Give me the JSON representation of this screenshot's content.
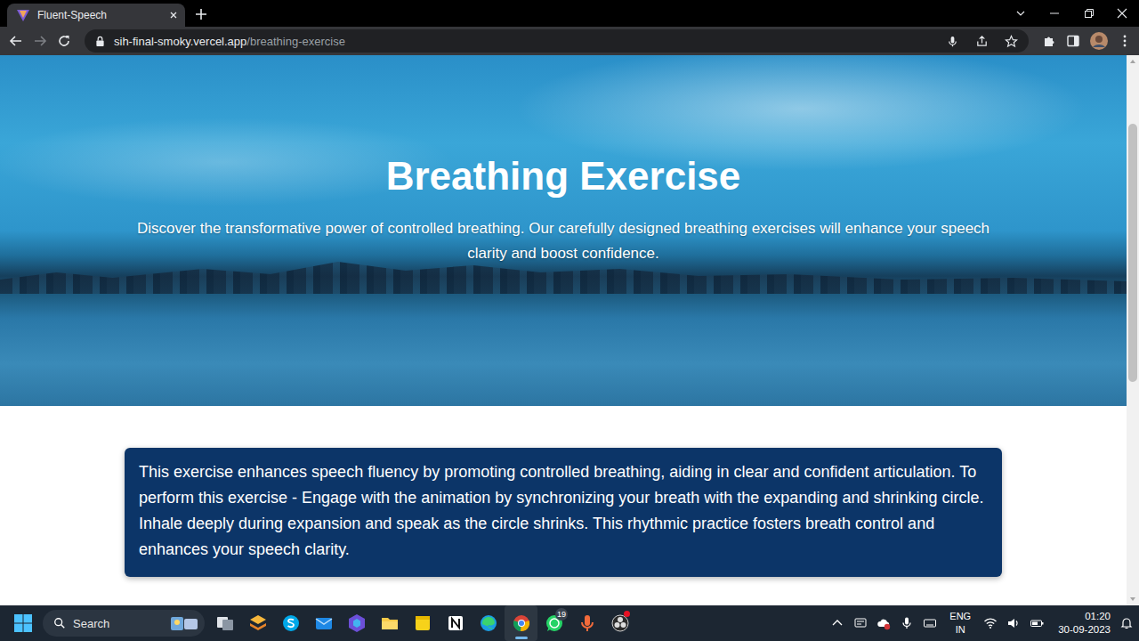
{
  "browser": {
    "tabs": [
      {
        "title": "Fluent-Speech",
        "selected": true
      }
    ],
    "url": {
      "host": "sih-final-smoky.vercel.app",
      "path": "/breathing-exercise"
    },
    "scrollbar": {
      "level": 0.21
    }
  },
  "page": {
    "hero": {
      "title": "Breathing Exercise",
      "subtitle": "Discover the transformative power of controlled breathing. Our carefully designed breathing exercises will enhance your speech clarity and boost confidence."
    },
    "instructions": "This exercise enhances speech fluency by promoting controlled breathing, aiding in clear and confident articulation. To perform this exercise - Engage with the animation by synchronizing your breath with the expanding and shrinking circle. Inhale deeply during expansion and speak as the circle shrinks. This rhythmic practice fosters breath control and enhances your speech clarity."
  },
  "taskbar": {
    "search": {
      "placeholder": "Search"
    },
    "apps": [
      {
        "kind": "taskview",
        "active": false,
        "badge": "",
        "alert": false
      },
      {
        "kind": "layers",
        "active": false,
        "badge": "",
        "alert": false
      },
      {
        "kind": "skype",
        "active": false,
        "badge": "",
        "alert": false
      },
      {
        "kind": "mail",
        "active": false,
        "badge": "",
        "alert": false
      },
      {
        "kind": "hexagon",
        "active": false,
        "badge": "",
        "alert": false
      },
      {
        "kind": "files",
        "active": false,
        "badge": "",
        "alert": false
      },
      {
        "kind": "notes",
        "active": false,
        "badge": "",
        "alert": false
      },
      {
        "kind": "notion",
        "active": false,
        "badge": "",
        "alert": false
      },
      {
        "kind": "edge",
        "active": false,
        "badge": "",
        "alert": false
      },
      {
        "kind": "chrome",
        "active": true,
        "badge": "",
        "alert": false
      },
      {
        "kind": "whatsapp",
        "active": false,
        "badge": "19",
        "alert": false
      },
      {
        "kind": "recorder",
        "active": false,
        "badge": "",
        "alert": false
      },
      {
        "kind": "obs",
        "active": false,
        "badge": "",
        "alert": true
      }
    ],
    "tray": {
      "language": "ENG",
      "region": "IN",
      "time": "01:20",
      "date": "30-09-2023"
    }
  }
}
